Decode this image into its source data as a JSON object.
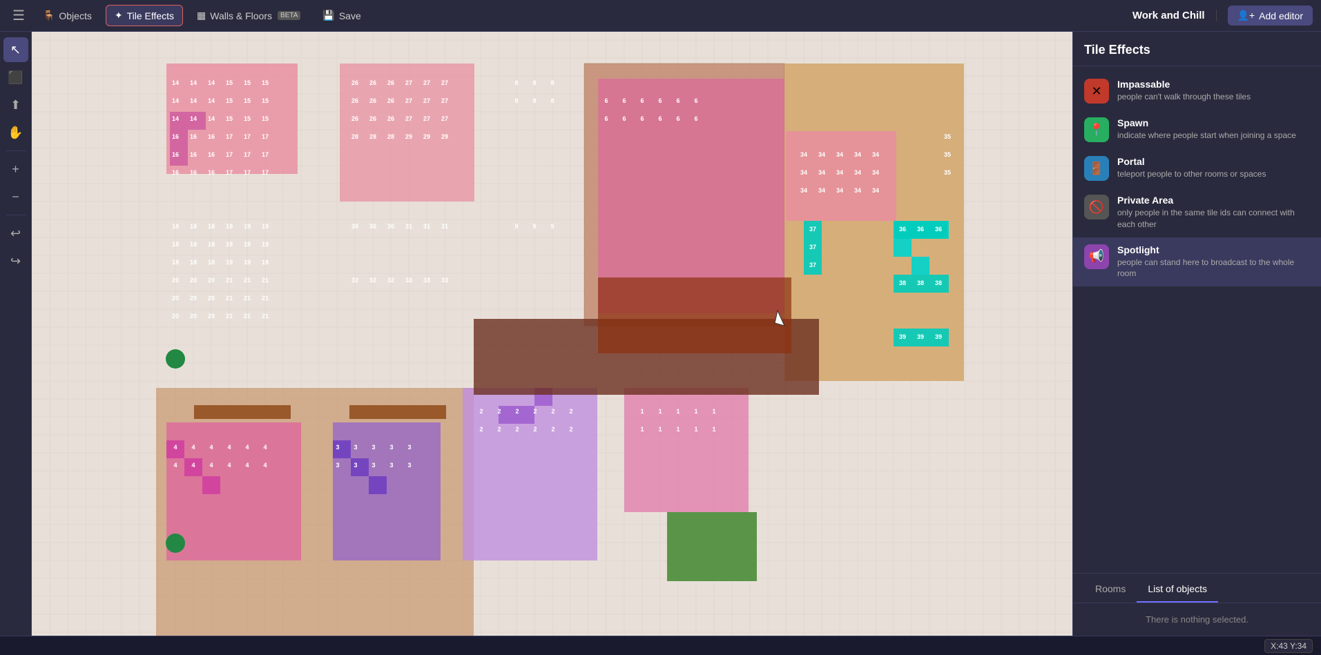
{
  "toolbar": {
    "menu_icon": "☰",
    "objects_label": "Objects",
    "tile_effects_label": "Tile Effects",
    "walls_floors_label": "Walls & Floors",
    "walls_floors_badge": "BETA",
    "save_label": "Save",
    "workspace_name": "Work and Chill",
    "add_editor_label": "Add editor"
  },
  "tools": [
    {
      "name": "select",
      "icon": "↖",
      "active": true
    },
    {
      "name": "eraser",
      "icon": "◻"
    },
    {
      "name": "upload",
      "icon": "⬆"
    },
    {
      "name": "hand",
      "icon": "✋"
    },
    {
      "name": "zoom-in",
      "icon": "+"
    },
    {
      "name": "zoom-out",
      "icon": "−"
    },
    {
      "name": "undo",
      "icon": "↩"
    },
    {
      "name": "redo",
      "icon": "↪"
    }
  ],
  "right_panel": {
    "title": "Tile Effects",
    "effects": [
      {
        "name": "Impassable",
        "desc": "people can't walk through these tiles",
        "icon": "✕",
        "color": "red"
      },
      {
        "name": "Spawn",
        "desc": "indicate where people start when joining a space",
        "icon": "📍",
        "color": "green"
      },
      {
        "name": "Portal",
        "desc": "teleport people to other rooms or spaces",
        "icon": "🚪",
        "color": "blue"
      },
      {
        "name": "Private Area",
        "desc": "only people in the same tile ids can connect with each other",
        "icon": "🚫",
        "color": "grey"
      },
      {
        "name": "Spotlight",
        "desc": "people can stand here to broadcast to the whole room",
        "icon": "📢",
        "color": "purple",
        "active": true
      }
    ],
    "tabs": [
      {
        "label": "Rooms",
        "active": false
      },
      {
        "label": "List of objects",
        "active": true
      }
    ],
    "nothing_selected": "There is nothing selected."
  },
  "status": {
    "coords": "X:43  Y:34"
  }
}
